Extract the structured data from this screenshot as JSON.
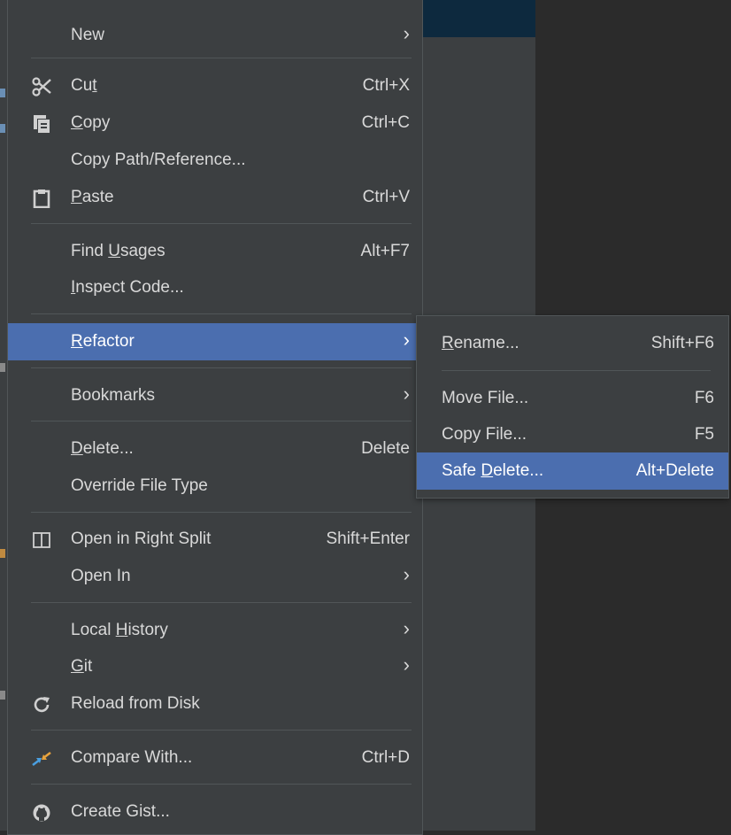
{
  "context_menu": {
    "items": [
      {
        "label": "New",
        "has_submenu": true
      },
      {
        "label_pre": "Cu",
        "mnemonic": "t",
        "label_post": "",
        "shortcut": "Ctrl+X",
        "icon": "scissors-icon"
      },
      {
        "label_pre": "",
        "mnemonic": "C",
        "label_post": "opy",
        "shortcut": "Ctrl+C",
        "icon": "copy-icon"
      },
      {
        "label": "Copy Path/Reference..."
      },
      {
        "label_pre": "",
        "mnemonic": "P",
        "label_post": "aste",
        "shortcut": "Ctrl+V",
        "icon": "clipboard-icon"
      },
      {
        "label_pre": "Find ",
        "mnemonic": "U",
        "label_post": "sages",
        "shortcut": "Alt+F7"
      },
      {
        "label_pre": "",
        "mnemonic": "I",
        "label_post": "nspect Code..."
      },
      {
        "label_pre": "",
        "mnemonic": "R",
        "label_post": "efactor",
        "has_submenu": true,
        "selected": true
      },
      {
        "label": "Bookmarks",
        "has_submenu": true
      },
      {
        "label_pre": "",
        "mnemonic": "D",
        "label_post": "elete...",
        "shortcut": "Delete"
      },
      {
        "label": "Override File Type"
      },
      {
        "label": "Open in Right Split",
        "shortcut": "Shift+Enter",
        "icon": "split-view-icon"
      },
      {
        "label": "Open In",
        "has_submenu": true
      },
      {
        "label_pre": "Local ",
        "mnemonic": "H",
        "label_post": "istory",
        "has_submenu": true
      },
      {
        "label_pre": "",
        "mnemonic": "G",
        "label_post": "it",
        "has_submenu": true
      },
      {
        "label": "Reload from Disk",
        "icon": "reload-icon"
      },
      {
        "label": "Compare With...",
        "shortcut": "Ctrl+D",
        "icon": "compare-icon"
      },
      {
        "label": "Create Gist...",
        "icon": "github-icon"
      }
    ]
  },
  "refactor_submenu": {
    "items": [
      {
        "label_pre": "",
        "mnemonic": "R",
        "label_post": "ename...",
        "shortcut": "Shift+F6"
      },
      {
        "label": "Move File...",
        "shortcut": "F6"
      },
      {
        "label": "Copy File...",
        "shortcut": "F5"
      },
      {
        "label_pre": "Safe ",
        "mnemonic": "D",
        "label_post": "elete...",
        "shortcut": "Alt+Delete",
        "selected": true
      }
    ]
  },
  "glyphs": {
    "submenu_arrow": "›"
  },
  "colors": {
    "menu_bg": "#3c3f41",
    "selection": "#4b6eaf",
    "text": "#d9d9d9",
    "separator": "#515658"
  }
}
